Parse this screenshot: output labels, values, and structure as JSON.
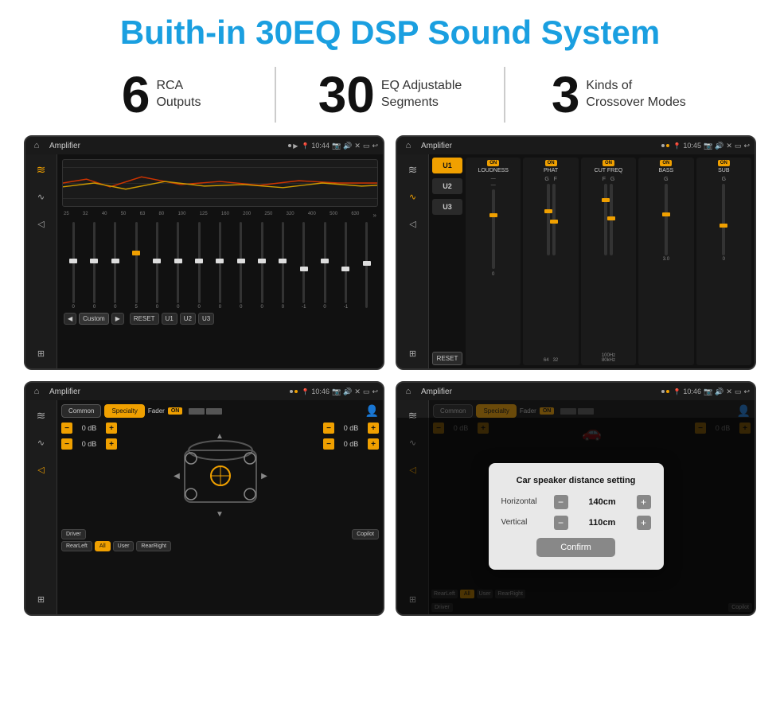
{
  "page": {
    "title": "Buith-in 30EQ DSP Sound System",
    "background": "#ffffff"
  },
  "stats": [
    {
      "number": "6",
      "label": "RCA\nOutputs"
    },
    {
      "number": "30",
      "label": "EQ Adjustable\nSegments"
    },
    {
      "number": "3",
      "label": "Kinds of\nCrossover Modes"
    }
  ],
  "screen1": {
    "title": "Amplifier",
    "time": "10:44",
    "freqs": [
      "25",
      "32",
      "40",
      "50",
      "63",
      "80",
      "100",
      "125",
      "160",
      "200",
      "250",
      "320",
      "400",
      "500",
      "630"
    ],
    "values": [
      "0",
      "0",
      "0",
      "5",
      "0",
      "0",
      "0",
      "0",
      "0",
      "0",
      "0",
      "-1",
      "0",
      "-1",
      ""
    ],
    "preset": "Custom",
    "buttons": [
      "RESET",
      "U1",
      "U2",
      "U3"
    ]
  },
  "screen2": {
    "title": "Amplifier",
    "time": "10:45",
    "channels": [
      "U1",
      "U2",
      "U3"
    ],
    "controls": [
      "LOUDNESS",
      "PHAT",
      "CUT FREQ",
      "BASS",
      "SUB"
    ]
  },
  "screen3": {
    "title": "Amplifier",
    "time": "10:46",
    "tabs": [
      "Common",
      "Specialty"
    ],
    "fader_label": "Fader",
    "on_label": "ON",
    "db_values": [
      "0 dB",
      "0 dB",
      "0 dB",
      "0 dB"
    ],
    "bottom_btns": [
      "Driver",
      "",
      "Copilot",
      "RearLeft",
      "All",
      "",
      "User",
      "RearRight"
    ]
  },
  "screen4": {
    "title": "Amplifier",
    "time": "10:46",
    "tabs": [
      "Common",
      "Specialty"
    ],
    "dialog": {
      "title": "Car speaker distance setting",
      "horizontal_label": "Horizontal",
      "horizontal_value": "140cm",
      "vertical_label": "Vertical",
      "vertical_value": "110cm",
      "confirm_label": "Confirm"
    }
  }
}
